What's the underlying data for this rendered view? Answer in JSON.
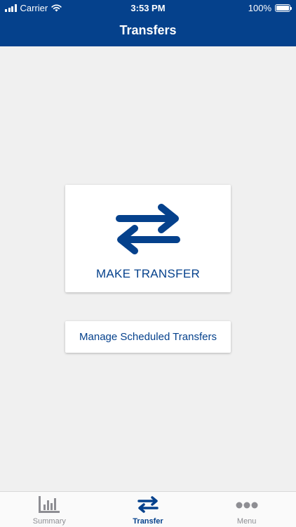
{
  "status_bar": {
    "carrier": "Carrier",
    "time": "3:53 PM",
    "battery": "100%"
  },
  "header": {
    "title": "Transfers"
  },
  "main": {
    "make_transfer_label": "MAKE TRANSFER",
    "manage_scheduled_label": "Manage Scheduled Transfers"
  },
  "tabbar": {
    "items": [
      {
        "label": "Summary",
        "icon": "bar-chart-icon",
        "active": false
      },
      {
        "label": "Transfer",
        "icon": "transfer-arrows-icon",
        "active": true
      },
      {
        "label": "Menu",
        "icon": "more-dots-icon",
        "active": false
      }
    ]
  },
  "colors": {
    "brand": "#05418c",
    "background": "#f0f0f0",
    "inactive": "#8e8e93"
  }
}
